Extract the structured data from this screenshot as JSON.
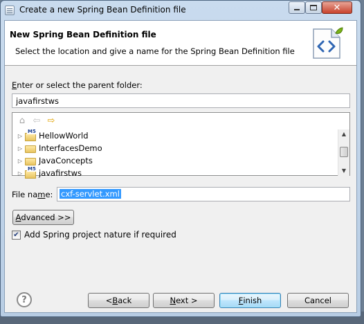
{
  "window": {
    "title": "Create a new Spring Bean Definition file",
    "close_glyph": "✕"
  },
  "header": {
    "title": "New Spring Bean Definition file",
    "description": "Select the location and give a name for the Spring Bean Definition file",
    "icon": "spring-bean-xml-icon"
  },
  "folder": {
    "label_hotkey": "E",
    "label_rest": "nter or select the parent folder:",
    "value": "javafirstws"
  },
  "tree": {
    "toolbar": {
      "home_icon": "home-icon",
      "back_icon": "back-arrow-icon",
      "forward_icon": "forward-arrow-icon"
    },
    "items": [
      {
        "label": "HellowWorld",
        "icon": "maven-project-icon"
      },
      {
        "label": "InterfacesDemo",
        "icon": "folder-icon"
      },
      {
        "label": "JavaConcepts",
        "icon": "folder-icon"
      },
      {
        "label": "javafirstws",
        "icon": "maven-project-icon"
      }
    ]
  },
  "file_name": {
    "label_before": "File na",
    "label_hotkey": "m",
    "label_after": "e:",
    "value": "cxf-servlet.xml"
  },
  "advanced_button": {
    "hotkey": "A",
    "rest": "dvanced >>"
  },
  "checkbox": {
    "label": "Add Spring project nature if required",
    "checked": true,
    "mark": "✔"
  },
  "buttons": {
    "back": {
      "before": "< ",
      "hotkey": "B",
      "after": "ack"
    },
    "next": {
      "hotkey": "N",
      "after": "ext >"
    },
    "finish": {
      "hotkey": "F",
      "after": "inish"
    },
    "cancel": "Cancel"
  },
  "help_glyph": "?"
}
